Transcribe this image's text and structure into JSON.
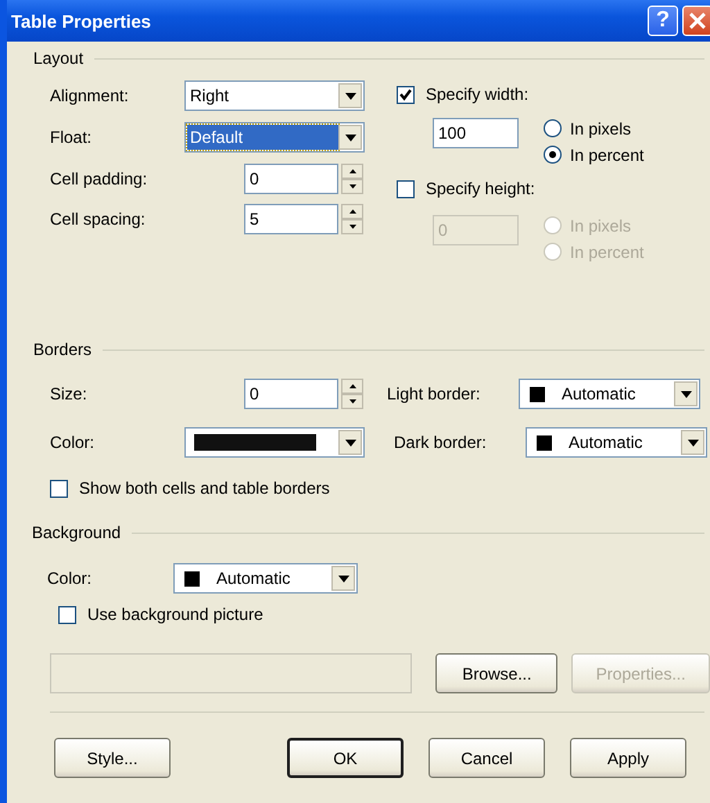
{
  "window": {
    "title": "Table Properties",
    "help": "?"
  },
  "layout": {
    "legend": "Layout",
    "alignment": {
      "label": "Alignment:",
      "value": "Right",
      "focused": false
    },
    "float": {
      "label": "Float:",
      "value": "Default",
      "focused": true
    },
    "cell_padding": {
      "label": "Cell padding:",
      "value": "0"
    },
    "cell_spacing": {
      "label": "Cell spacing:",
      "value": "5"
    },
    "specify_width": {
      "label": "Specify width:",
      "checked": true,
      "value": "100",
      "disabled": false,
      "units": [
        {
          "label": "In pixels",
          "selected": false
        },
        {
          "label": "In percent",
          "selected": true
        }
      ]
    },
    "specify_height": {
      "label": "Specify height:",
      "checked": false,
      "value": "0",
      "disabled": true,
      "units": [
        {
          "label": "In pixels",
          "selected": false
        },
        {
          "label": "In percent",
          "selected": false
        }
      ]
    }
  },
  "borders": {
    "legend": "Borders",
    "size": {
      "label": "Size:",
      "value": "0"
    },
    "color": {
      "label": "Color:",
      "color": "#111111"
    },
    "light_border": {
      "label": "Light border:",
      "value": "Automatic",
      "color": "#000000"
    },
    "dark_border": {
      "label": "Dark border:",
      "value": "Automatic",
      "color": "#000000"
    },
    "show_both": {
      "label": "Show both cells and table borders",
      "checked": false
    }
  },
  "background": {
    "legend": "Background",
    "color": {
      "label": "Color:",
      "value": "Automatic",
      "color": "#000000"
    },
    "use_picture": {
      "label": "Use background picture",
      "checked": false
    },
    "browse": {
      "label": "Browse...",
      "disabled": false
    },
    "properties": {
      "label": "Properties...",
      "disabled": true
    }
  },
  "buttons": [
    {
      "label": "Style...",
      "default": false
    },
    {
      "label": "OK",
      "default": true
    },
    {
      "label": "Cancel",
      "default": false
    },
    {
      "label": "Apply",
      "default": false
    }
  ]
}
